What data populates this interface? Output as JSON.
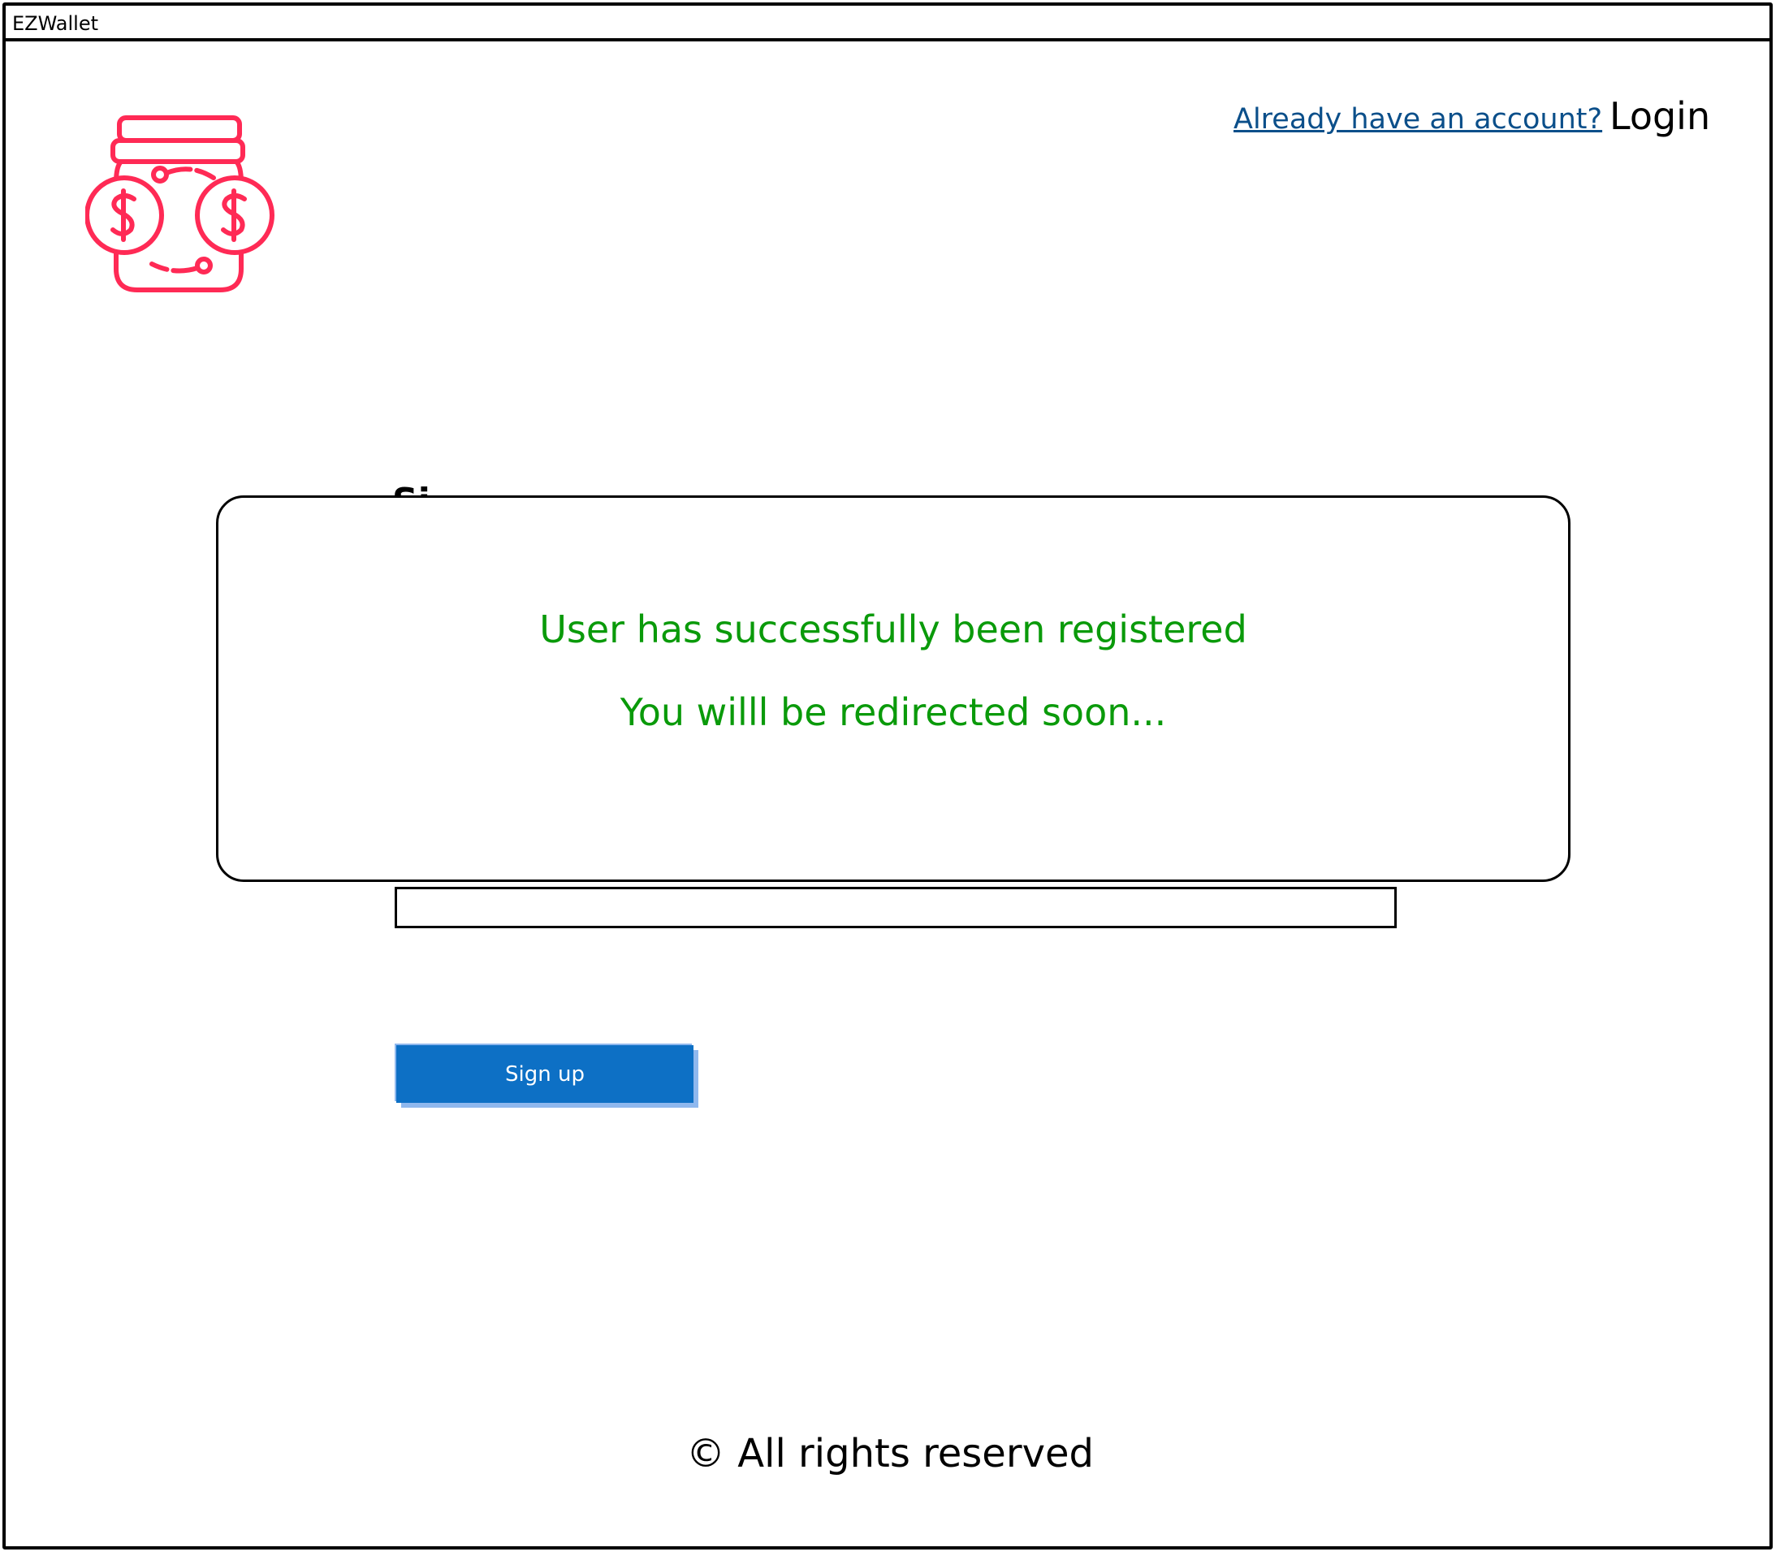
{
  "window": {
    "title": "EZWallet"
  },
  "header": {
    "account_link": "Already have an account?",
    "login_label": "Login"
  },
  "form": {
    "heading_partial": "Si",
    "signup_label": "Sign up"
  },
  "modal": {
    "line1": "User has successfully been registered",
    "line2": "You willl be redirected soon..."
  },
  "footer": {
    "text": "© All rights reserved"
  },
  "colors": {
    "accent_blue": "#0d70c5",
    "link_blue": "#0b4f8a",
    "success_green": "#0a9a0a",
    "logo_red": "#ff2a55"
  },
  "icons": {
    "logo": "money-jar-icon"
  }
}
